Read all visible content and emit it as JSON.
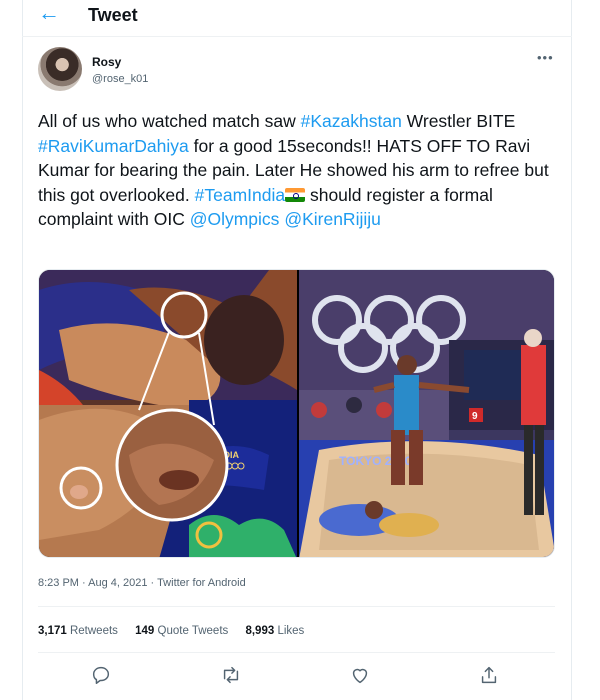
{
  "header": {
    "back_icon": "arrow-left-icon",
    "title": "Tweet",
    "accent": "#1d9bf0"
  },
  "author": {
    "name": "Rosy",
    "handle": "@rose_k01",
    "more_icon": "more-options-icon"
  },
  "tweet": {
    "segments": [
      {
        "text": "All of us who watched match saw ",
        "link": false
      },
      {
        "text": "#Kazakhstan",
        "link": true
      },
      {
        "text": " Wrestler BITE ",
        "link": false
      },
      {
        "text": "#RaviKumarDahiya",
        "link": true
      },
      {
        "text": " for a good 15seconds!! HATS OFF TO Ravi Kumar for bearing the pain. Later He showed his arm to refree but this got overlooked. ",
        "link": false
      },
      {
        "text": "#TeamIndia",
        "link": true
      },
      {
        "text": " should register a formal complaint with OIC ",
        "link": false
      },
      {
        "text": "@Olympics",
        "link": true
      },
      {
        "text": " ",
        "link": false
      },
      {
        "text": "@KirenRijiju",
        "link": true
      }
    ],
    "flag_icon": "india-flag-emoji",
    "media": {
      "left_badge_text": "NDIA",
      "right_scoreboard_text": "9",
      "right_banner_text": "TOKYO 2020"
    }
  },
  "meta": {
    "time": "8:23 PM",
    "separator": " · ",
    "date": "Aug 4, 2021",
    "source": "Twitter for Android"
  },
  "stats": {
    "retweets_count": "3,171",
    "retweets_label": "Retweets",
    "quotes_count": "149",
    "quotes_label": "Quote Tweets",
    "likes_count": "8,993",
    "likes_label": "Likes"
  },
  "actions": {
    "reply_icon": "reply-icon",
    "retweet_icon": "retweet-icon",
    "like_icon": "like-icon",
    "share_icon": "share-icon"
  },
  "colors": {
    "link": "#1d9bf0",
    "text": "#0f1419",
    "secondary": "#536471",
    "divider": "#eef1f3"
  }
}
